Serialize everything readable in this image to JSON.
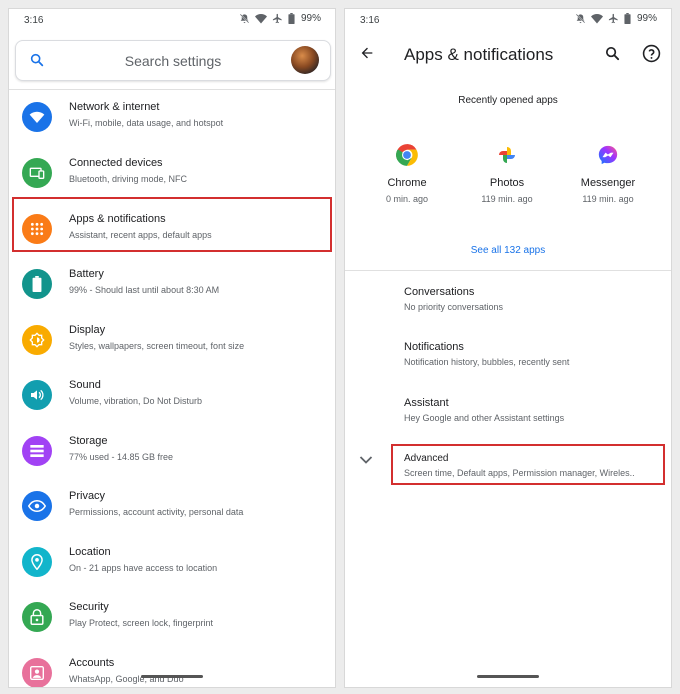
{
  "left": {
    "status": {
      "time": "3:16",
      "battery": "99%"
    },
    "search": {
      "placeholder": "Search settings"
    },
    "items": [
      {
        "title": "Network & internet",
        "subtitle": "Wi-Fi, mobile, data usage, and hotspot",
        "icon": "wifi-icon",
        "color": "#1a73e8"
      },
      {
        "title": "Connected devices",
        "subtitle": "Bluetooth, driving mode, NFC",
        "icon": "devices-icon",
        "color": "#34a853"
      },
      {
        "title": "Apps & notifications",
        "subtitle": "Assistant, recent apps, default apps",
        "icon": "apps-grid-icon",
        "color": "#fa7b17"
      },
      {
        "title": "Battery",
        "subtitle": "99% - Should last until about 8:30 AM",
        "icon": "battery-icon",
        "color": "#12948c"
      },
      {
        "title": "Display",
        "subtitle": "Styles, wallpapers, screen timeout, font size",
        "icon": "brightness-icon",
        "color": "#f9ab00"
      },
      {
        "title": "Sound",
        "subtitle": "Volume, vibration, Do Not Disturb",
        "icon": "volume-icon",
        "color": "#129eaf"
      },
      {
        "title": "Storage",
        "subtitle": "77% used - 14.85 GB free",
        "icon": "storage-icon",
        "color": "#a142f4"
      },
      {
        "title": "Privacy",
        "subtitle": "Permissions, account activity, personal data",
        "icon": "privacy-eye-icon",
        "color": "#1a73e8"
      },
      {
        "title": "Location",
        "subtitle": "On - 21 apps have access to location",
        "icon": "location-pin-icon",
        "color": "#12b5cb"
      },
      {
        "title": "Security",
        "subtitle": "Play Protect, screen lock, fingerprint",
        "icon": "lock-icon",
        "color": "#34a853"
      },
      {
        "title": "Accounts",
        "subtitle": "WhatsApp, Google, and Duo",
        "icon": "account-box-icon",
        "color": "#e8719b"
      }
    ]
  },
  "right": {
    "status": {
      "time": "3:16",
      "battery": "99%"
    },
    "title": "Apps & notifications",
    "recent_label": "Recently opened apps",
    "apps": [
      {
        "name": "Chrome",
        "time": "0 min. ago",
        "icon": "chrome-icon"
      },
      {
        "name": "Photos",
        "time": "119 min. ago",
        "icon": "photos-icon"
      },
      {
        "name": "Messenger",
        "time": "119 min. ago",
        "icon": "messenger-icon"
      }
    ],
    "see_all": "See all 132 apps",
    "items": [
      {
        "title": "Conversations",
        "subtitle": "No priority conversations"
      },
      {
        "title": "Notifications",
        "subtitle": "Notification history, bubbles, recently sent"
      },
      {
        "title": "Assistant",
        "subtitle": "Hey Google and other Assistant settings"
      },
      {
        "title": "Advanced",
        "subtitle": "Screen time, Default apps, Permission manager, Wireles.."
      }
    ]
  },
  "colors": {
    "highlight": "#d32f2f",
    "link": "#1a73e8"
  }
}
